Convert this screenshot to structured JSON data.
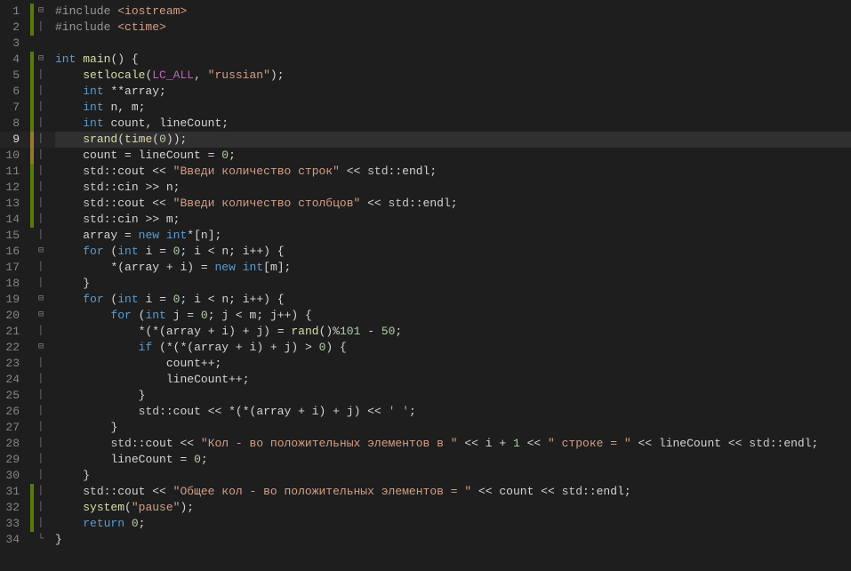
{
  "editor": {
    "current_line": 9,
    "lines": [
      {
        "num": 1,
        "mod": "green",
        "fold": "min",
        "tokens": [
          [
            "pp",
            "#include "
          ],
          [
            "hdr",
            "<iostream>"
          ]
        ]
      },
      {
        "num": 2,
        "mod": "green",
        "fold": "bar",
        "tokens": [
          [
            "pp",
            "#include "
          ],
          [
            "hdr",
            "<ctime>"
          ]
        ]
      },
      {
        "num": 3,
        "mod": "",
        "fold": "",
        "tokens": []
      },
      {
        "num": 4,
        "mod": "green",
        "fold": "min",
        "tokens": [
          [
            "kw",
            "int"
          ],
          [
            "op",
            " "
          ],
          [
            "fn",
            "main"
          ],
          [
            "op",
            "() {"
          ]
        ]
      },
      {
        "num": 5,
        "mod": "green",
        "fold": "bar",
        "indent": 1,
        "tokens": [
          [
            "fn",
            "setlocale"
          ],
          [
            "op",
            "("
          ],
          [
            "mac",
            "LC_ALL"
          ],
          [
            "op",
            ", "
          ],
          [
            "str",
            "\"russian\""
          ],
          [
            "op",
            ");"
          ]
        ]
      },
      {
        "num": 6,
        "mod": "green",
        "fold": "bar",
        "indent": 1,
        "tokens": [
          [
            "kw",
            "int"
          ],
          [
            "op",
            " **"
          ],
          [
            "id",
            "array"
          ],
          [
            "op",
            ";"
          ]
        ]
      },
      {
        "num": 7,
        "mod": "green",
        "fold": "bar",
        "indent": 1,
        "tokens": [
          [
            "kw",
            "int"
          ],
          [
            "op",
            " "
          ],
          [
            "id",
            "n"
          ],
          [
            "op",
            ", "
          ],
          [
            "id",
            "m"
          ],
          [
            "op",
            ";"
          ]
        ]
      },
      {
        "num": 8,
        "mod": "green",
        "fold": "bar",
        "indent": 1,
        "tokens": [
          [
            "kw",
            "int"
          ],
          [
            "op",
            " "
          ],
          [
            "id",
            "count"
          ],
          [
            "op",
            ", "
          ],
          [
            "id",
            "lineCount"
          ],
          [
            "op",
            ";"
          ]
        ]
      },
      {
        "num": 9,
        "mod": "yellow",
        "fold": "bar",
        "indent": 1,
        "hl": true,
        "tokens": [
          [
            "fn",
            "srand"
          ],
          [
            "op",
            "("
          ],
          [
            "fn",
            "time"
          ],
          [
            "op",
            "("
          ],
          [
            "num",
            "0"
          ],
          [
            "op",
            "));"
          ]
        ]
      },
      {
        "num": 10,
        "mod": "yellow",
        "fold": "bar",
        "indent": 1,
        "tokens": [
          [
            "id",
            "count"
          ],
          [
            "op",
            " = "
          ],
          [
            "id",
            "lineCount"
          ],
          [
            "op",
            " = "
          ],
          [
            "num",
            "0"
          ],
          [
            "op",
            ";"
          ]
        ]
      },
      {
        "num": 11,
        "mod": "green",
        "fold": "bar",
        "indent": 1,
        "tokens": [
          [
            "ns",
            "std"
          ],
          [
            "op",
            "::"
          ],
          [
            "id",
            "cout"
          ],
          [
            "op",
            " << "
          ],
          [
            "str",
            "\"Введи количество строк\""
          ],
          [
            "op",
            " << "
          ],
          [
            "ns",
            "std"
          ],
          [
            "op",
            "::"
          ],
          [
            "id",
            "endl"
          ],
          [
            "op",
            ";"
          ]
        ]
      },
      {
        "num": 12,
        "mod": "green",
        "fold": "bar",
        "indent": 1,
        "tokens": [
          [
            "ns",
            "std"
          ],
          [
            "op",
            "::"
          ],
          [
            "id",
            "cin"
          ],
          [
            "op",
            " >> "
          ],
          [
            "id",
            "n"
          ],
          [
            "op",
            ";"
          ]
        ]
      },
      {
        "num": 13,
        "mod": "green",
        "fold": "bar",
        "indent": 1,
        "tokens": [
          [
            "ns",
            "std"
          ],
          [
            "op",
            "::"
          ],
          [
            "id",
            "cout"
          ],
          [
            "op",
            " << "
          ],
          [
            "str",
            "\"Введи количество столбцов\""
          ],
          [
            "op",
            " << "
          ],
          [
            "ns",
            "std"
          ],
          [
            "op",
            "::"
          ],
          [
            "id",
            "endl"
          ],
          [
            "op",
            ";"
          ]
        ]
      },
      {
        "num": 14,
        "mod": "green",
        "fold": "bar",
        "indent": 1,
        "tokens": [
          [
            "ns",
            "std"
          ],
          [
            "op",
            "::"
          ],
          [
            "id",
            "cin"
          ],
          [
            "op",
            " >> "
          ],
          [
            "id",
            "m"
          ],
          [
            "op",
            ";"
          ]
        ]
      },
      {
        "num": 15,
        "mod": "",
        "fold": "bar",
        "indent": 1,
        "tokens": [
          [
            "id",
            "array"
          ],
          [
            "op",
            " = "
          ],
          [
            "kw",
            "new"
          ],
          [
            "op",
            " "
          ],
          [
            "kw",
            "int"
          ],
          [
            "op",
            "*["
          ],
          [
            "id",
            "n"
          ],
          [
            "op",
            "];"
          ]
        ]
      },
      {
        "num": 16,
        "mod": "",
        "fold": "min",
        "indent": 1,
        "tokens": [
          [
            "kw",
            "for"
          ],
          [
            "op",
            " ("
          ],
          [
            "kw",
            "int"
          ],
          [
            "op",
            " "
          ],
          [
            "id",
            "i"
          ],
          [
            "op",
            " = "
          ],
          [
            "num",
            "0"
          ],
          [
            "op",
            "; "
          ],
          [
            "id",
            "i"
          ],
          [
            "op",
            " < "
          ],
          [
            "id",
            "n"
          ],
          [
            "op",
            "; "
          ],
          [
            "id",
            "i"
          ],
          [
            "op",
            "++) {"
          ]
        ]
      },
      {
        "num": 17,
        "mod": "",
        "fold": "bar",
        "indent": 2,
        "tokens": [
          [
            "op",
            "*("
          ],
          [
            "id",
            "array"
          ],
          [
            "op",
            " + "
          ],
          [
            "id",
            "i"
          ],
          [
            "op",
            ") = "
          ],
          [
            "kw",
            "new"
          ],
          [
            "op",
            " "
          ],
          [
            "kw",
            "int"
          ],
          [
            "op",
            "["
          ],
          [
            "id",
            "m"
          ],
          [
            "op",
            "];"
          ]
        ]
      },
      {
        "num": 18,
        "mod": "",
        "fold": "bar",
        "indent": 1,
        "tokens": [
          [
            "op",
            "}"
          ]
        ]
      },
      {
        "num": 19,
        "mod": "",
        "fold": "min",
        "indent": 1,
        "tokens": [
          [
            "kw",
            "for"
          ],
          [
            "op",
            " ("
          ],
          [
            "kw",
            "int"
          ],
          [
            "op",
            " "
          ],
          [
            "id",
            "i"
          ],
          [
            "op",
            " = "
          ],
          [
            "num",
            "0"
          ],
          [
            "op",
            "; "
          ],
          [
            "id",
            "i"
          ],
          [
            "op",
            " < "
          ],
          [
            "id",
            "n"
          ],
          [
            "op",
            "; "
          ],
          [
            "id",
            "i"
          ],
          [
            "op",
            "++) {"
          ]
        ]
      },
      {
        "num": 20,
        "mod": "",
        "fold": "min",
        "indent": 2,
        "tokens": [
          [
            "kw",
            "for"
          ],
          [
            "op",
            " ("
          ],
          [
            "kw",
            "int"
          ],
          [
            "op",
            " "
          ],
          [
            "id",
            "j"
          ],
          [
            "op",
            " = "
          ],
          [
            "num",
            "0"
          ],
          [
            "op",
            "; "
          ],
          [
            "id",
            "j"
          ],
          [
            "op",
            " < "
          ],
          [
            "id",
            "m"
          ],
          [
            "op",
            "; "
          ],
          [
            "id",
            "j"
          ],
          [
            "op",
            "++) {"
          ]
        ]
      },
      {
        "num": 21,
        "mod": "",
        "fold": "bar",
        "indent": 3,
        "tokens": [
          [
            "op",
            "*(*("
          ],
          [
            "id",
            "array"
          ],
          [
            "op",
            " + "
          ],
          [
            "id",
            "i"
          ],
          [
            "op",
            ") + "
          ],
          [
            "id",
            "j"
          ],
          [
            "op",
            ") = "
          ],
          [
            "fn",
            "rand"
          ],
          [
            "op",
            "()%"
          ],
          [
            "num",
            "101"
          ],
          [
            "op",
            " - "
          ],
          [
            "num",
            "50"
          ],
          [
            "op",
            ";"
          ]
        ]
      },
      {
        "num": 22,
        "mod": "",
        "fold": "min",
        "indent": 3,
        "tokens": [
          [
            "kw",
            "if"
          ],
          [
            "op",
            " (*(*("
          ],
          [
            "id",
            "array"
          ],
          [
            "op",
            " + "
          ],
          [
            "id",
            "i"
          ],
          [
            "op",
            ") + "
          ],
          [
            "id",
            "j"
          ],
          [
            "op",
            ") > "
          ],
          [
            "num",
            "0"
          ],
          [
            "op",
            ") {"
          ]
        ]
      },
      {
        "num": 23,
        "mod": "",
        "fold": "bar",
        "indent": 4,
        "tokens": [
          [
            "id",
            "count"
          ],
          [
            "op",
            "++;"
          ]
        ]
      },
      {
        "num": 24,
        "mod": "",
        "fold": "bar",
        "indent": 4,
        "tokens": [
          [
            "id",
            "lineCount"
          ],
          [
            "op",
            "++;"
          ]
        ]
      },
      {
        "num": 25,
        "mod": "",
        "fold": "bar",
        "indent": 3,
        "tokens": [
          [
            "op",
            "}"
          ]
        ]
      },
      {
        "num": 26,
        "mod": "",
        "fold": "bar",
        "indent": 3,
        "tokens": [
          [
            "ns",
            "std"
          ],
          [
            "op",
            "::"
          ],
          [
            "id",
            "cout"
          ],
          [
            "op",
            " << *(*("
          ],
          [
            "id",
            "array"
          ],
          [
            "op",
            " + "
          ],
          [
            "id",
            "i"
          ],
          [
            "op",
            ") + "
          ],
          [
            "id",
            "j"
          ],
          [
            "op",
            ") << "
          ],
          [
            "str",
            "' '"
          ],
          [
            "op",
            ";"
          ]
        ]
      },
      {
        "num": 27,
        "mod": "",
        "fold": "bar",
        "indent": 2,
        "tokens": [
          [
            "op",
            "}"
          ]
        ]
      },
      {
        "num": 28,
        "mod": "",
        "fold": "bar",
        "indent": 2,
        "tokens": [
          [
            "ns",
            "std"
          ],
          [
            "op",
            "::"
          ],
          [
            "id",
            "cout"
          ],
          [
            "op",
            " << "
          ],
          [
            "str",
            "\"Кол - во положительных элементов в \""
          ],
          [
            "op",
            " << "
          ],
          [
            "id",
            "i"
          ],
          [
            "op",
            " + "
          ],
          [
            "num",
            "1"
          ],
          [
            "op",
            " << "
          ],
          [
            "str",
            "\" строке = \""
          ],
          [
            "op",
            " << "
          ],
          [
            "id",
            "lineCount"
          ],
          [
            "op",
            " << "
          ],
          [
            "ns",
            "std"
          ],
          [
            "op",
            "::"
          ],
          [
            "id",
            "endl"
          ],
          [
            "op",
            ";"
          ]
        ]
      },
      {
        "num": 29,
        "mod": "",
        "fold": "bar",
        "indent": 2,
        "tokens": [
          [
            "id",
            "lineCount"
          ],
          [
            "op",
            " = "
          ],
          [
            "num",
            "0"
          ],
          [
            "op",
            ";"
          ]
        ]
      },
      {
        "num": 30,
        "mod": "",
        "fold": "bar",
        "indent": 1,
        "tokens": [
          [
            "op",
            "}"
          ]
        ]
      },
      {
        "num": 31,
        "mod": "green",
        "fold": "bar",
        "indent": 1,
        "tokens": [
          [
            "ns",
            "std"
          ],
          [
            "op",
            "::"
          ],
          [
            "id",
            "cout"
          ],
          [
            "op",
            " << "
          ],
          [
            "str",
            "\"Общее кол - во положительных элементов = \""
          ],
          [
            "op",
            " << "
          ],
          [
            "id",
            "count"
          ],
          [
            "op",
            " << "
          ],
          [
            "ns",
            "std"
          ],
          [
            "op",
            "::"
          ],
          [
            "id",
            "endl"
          ],
          [
            "op",
            ";"
          ]
        ]
      },
      {
        "num": 32,
        "mod": "green",
        "fold": "bar",
        "indent": 1,
        "tokens": [
          [
            "fn",
            "system"
          ],
          [
            "op",
            "("
          ],
          [
            "str",
            "\"pause\""
          ],
          [
            "op",
            ");"
          ]
        ]
      },
      {
        "num": 33,
        "mod": "green",
        "fold": "bar",
        "indent": 1,
        "tokens": [
          [
            "kw",
            "return"
          ],
          [
            "op",
            " "
          ],
          [
            "num",
            "0"
          ],
          [
            "op",
            ";"
          ]
        ]
      },
      {
        "num": 34,
        "mod": "",
        "fold": "end",
        "tokens": [
          [
            "op",
            "}"
          ]
        ]
      }
    ]
  },
  "fold_icons": {
    "min": "⊟",
    "bar": "│",
    "end": "└"
  }
}
